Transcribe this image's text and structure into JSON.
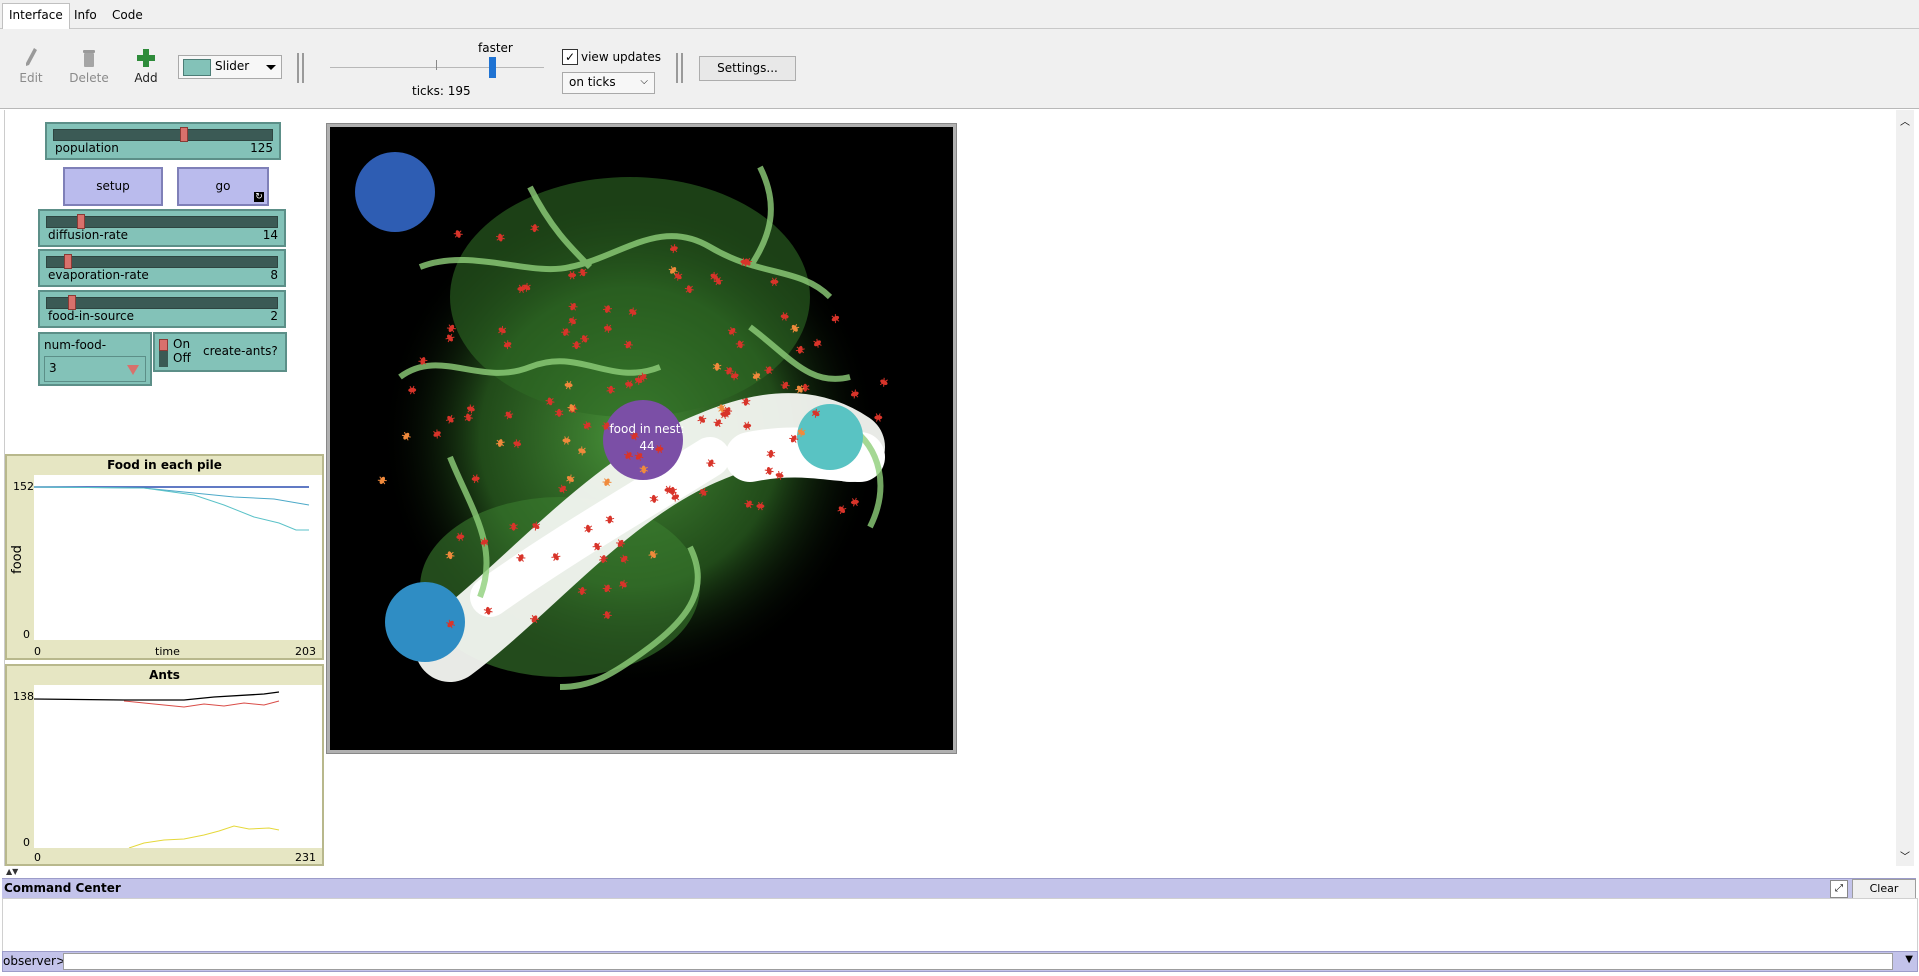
{
  "tabs": [
    {
      "label": "Interface",
      "active": true
    },
    {
      "label": "Info",
      "active": false
    },
    {
      "label": "Code",
      "active": false
    }
  ],
  "toolbar": {
    "edit_label": "Edit",
    "delete_label": "Delete",
    "add_label": "Add",
    "widget_type": "Slider",
    "speed_label": "faster",
    "ticks_label": "ticks: 195",
    "view_updates_label": "view updates",
    "view_updates_checked": true,
    "update_mode": "on ticks",
    "settings_label": "Settings..."
  },
  "widgets": {
    "population": {
      "label": "population",
      "value": "125",
      "fraction": 0.6
    },
    "setup_label": "setup",
    "go_label": "go",
    "diffusion": {
      "label": "diffusion-rate",
      "value": "14",
      "fraction": 0.14
    },
    "evaporation": {
      "label": "evaporation-rate",
      "value": "8",
      "fraction": 0.08
    },
    "food_in_source": {
      "label": "food-in-source",
      "value": "2",
      "fraction": 0.1
    },
    "num_food_sources": {
      "label": "num-food-sources",
      "value": "3"
    },
    "switch": {
      "on": "On",
      "off": "Off",
      "label": "create-ants?"
    }
  },
  "plots": {
    "food": {
      "title": "Food in each pile",
      "ylabel": "food",
      "xlabel": "time",
      "ymax": "152",
      "ymin": "0",
      "xmin": "0",
      "xmax": "203"
    },
    "ants": {
      "title": "Ants",
      "ymax": "138",
      "ymin": "0",
      "xmin": "0",
      "xmax": "231"
    }
  },
  "view": {
    "nest_label_line1": "food in nest:",
    "nest_label_line2": "44",
    "colors": {
      "pile1": "#2e5db3",
      "pile2": "#59c3c3",
      "pile3": "#2f8dc4",
      "nest": "#7b4fa6",
      "ant": "#d8342a"
    }
  },
  "command_center": {
    "title": "Command Center",
    "clear_label": "Clear",
    "prompt": "observer>"
  }
}
